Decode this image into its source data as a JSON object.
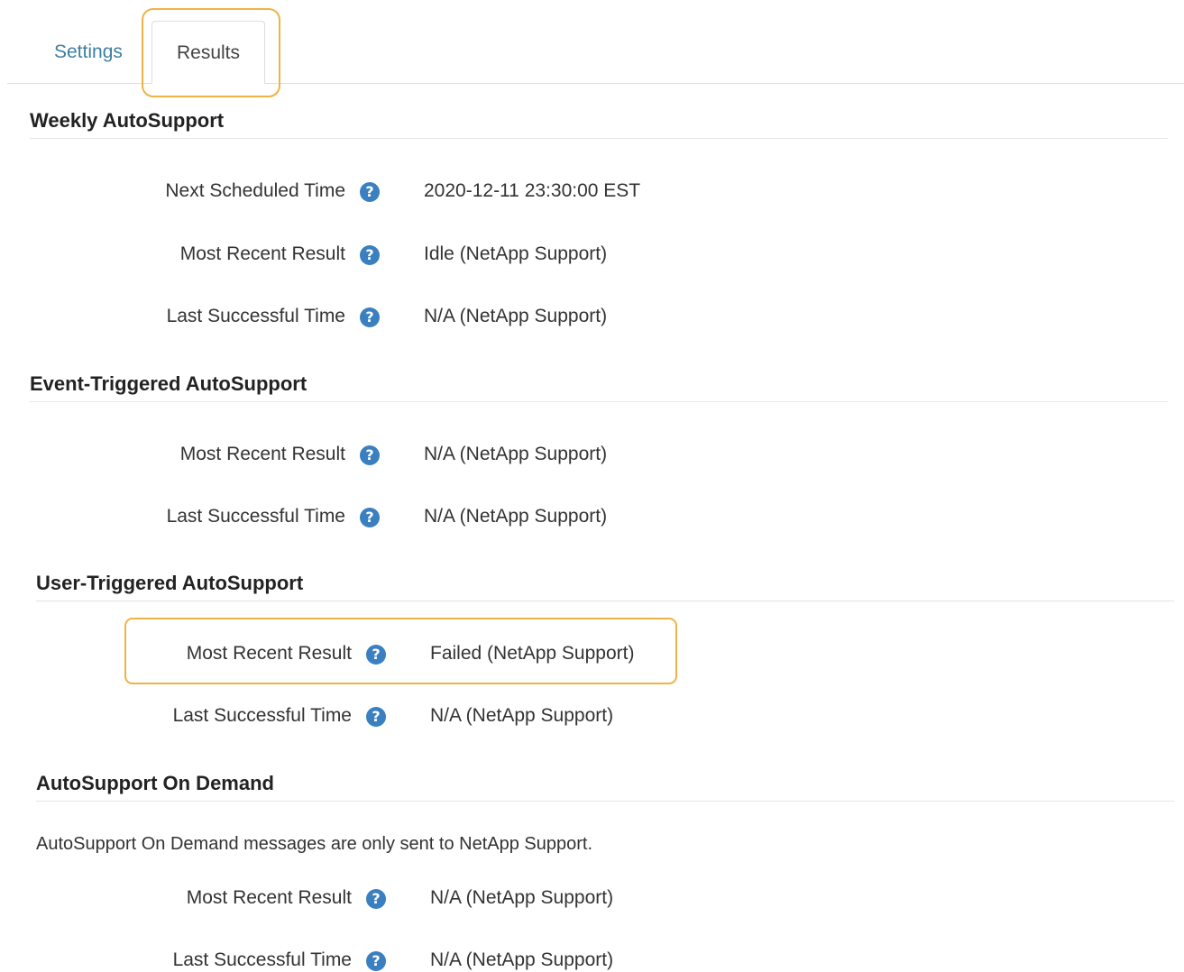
{
  "tabs": {
    "settings_label": "Settings",
    "results_label": "Results"
  },
  "weekly": {
    "title": "Weekly AutoSupport",
    "next_scheduled_label": "Next Scheduled Time",
    "next_scheduled_value": "2020-12-11 23:30:00 EST",
    "most_recent_label": "Most Recent Result",
    "most_recent_value": "Idle (NetApp Support)",
    "last_successful_label": "Last Successful Time",
    "last_successful_value": "N/A (NetApp Support)"
  },
  "event": {
    "title": "Event-Triggered AutoSupport",
    "most_recent_label": "Most Recent Result",
    "most_recent_value": "N/A (NetApp Support)",
    "last_successful_label": "Last Successful Time",
    "last_successful_value": "N/A (NetApp Support)"
  },
  "user": {
    "title": "User-Triggered AutoSupport",
    "most_recent_label": "Most Recent Result",
    "most_recent_value": "Failed (NetApp Support)",
    "last_successful_label": "Last Successful Time",
    "last_successful_value": "N/A (NetApp Support)"
  },
  "on_demand": {
    "title": "AutoSupport On Demand",
    "note": "AutoSupport On Demand messages are only sent to NetApp Support.",
    "most_recent_label": "Most Recent Result",
    "most_recent_value": "N/A (NetApp Support)",
    "last_successful_label": "Last Successful Time",
    "last_successful_value": "N/A (NetApp Support)"
  },
  "icons": {
    "help_glyph": "?",
    "help_color": "#3a7fbf",
    "highlight_color": "#f0b246"
  }
}
